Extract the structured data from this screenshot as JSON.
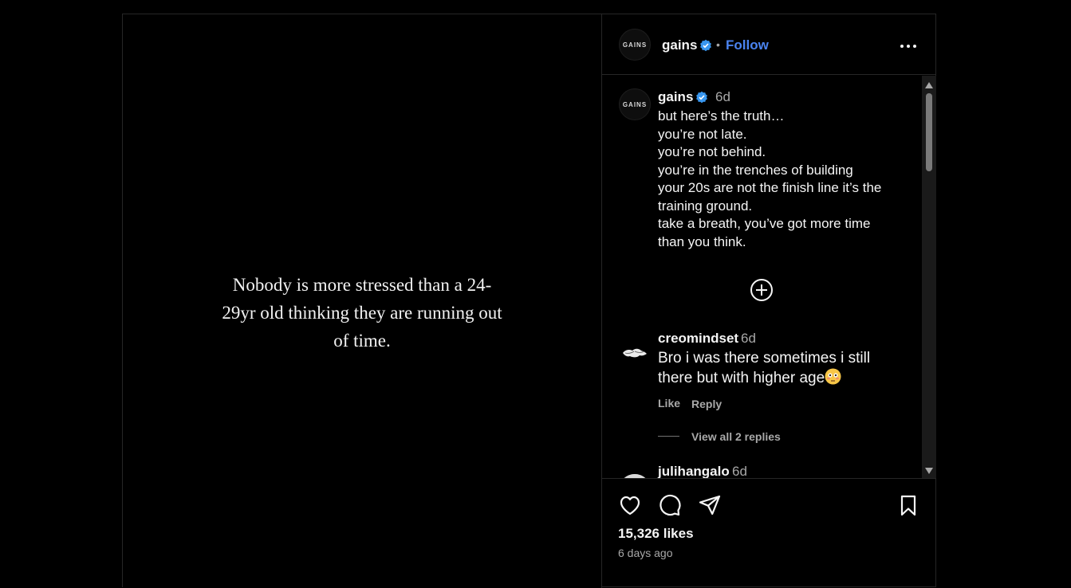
{
  "media": {
    "caption_text": "Nobody is more stressed than a 24-29yr old thinking they are running out of time."
  },
  "header": {
    "avatar_text": "GAINS",
    "username": "gains",
    "separator": "•",
    "follow_label": "Follow"
  },
  "caption": {
    "avatar_text": "GAINS",
    "username": "gains",
    "time": "6d",
    "lines": [
      "but here’s the truth…",
      "you’re not late.",
      "you’re not behind.",
      "you’re in the trenches of building",
      "your 20s are not the finish line it’s the",
      "training ground.",
      "take a breath, you’ve got more time",
      "than you think."
    ]
  },
  "comments": [
    {
      "username": "creomindset",
      "time": "6d",
      "text": "Bro i was there sometimes i still there but with higher age",
      "emoji": "flushed-face-emoji",
      "like_label": "Like",
      "reply_label": "Reply",
      "view_replies_label": "View all 2 replies"
    },
    {
      "username": "julihangalo",
      "time": "6d"
    }
  ],
  "actions": {
    "likes": "15,326 likes",
    "age": "6 days ago"
  },
  "colors": {
    "background": "#000000",
    "border": "#262626",
    "follow_blue": "#4a83f0",
    "verified_blue": "#3897f0",
    "muted_text": "#a8a8a8"
  },
  "icons": [
    "verified-icon",
    "more-options-icon",
    "add-circle-icon",
    "heart-icon",
    "comment-icon",
    "share-icon",
    "bookmark-icon"
  ]
}
